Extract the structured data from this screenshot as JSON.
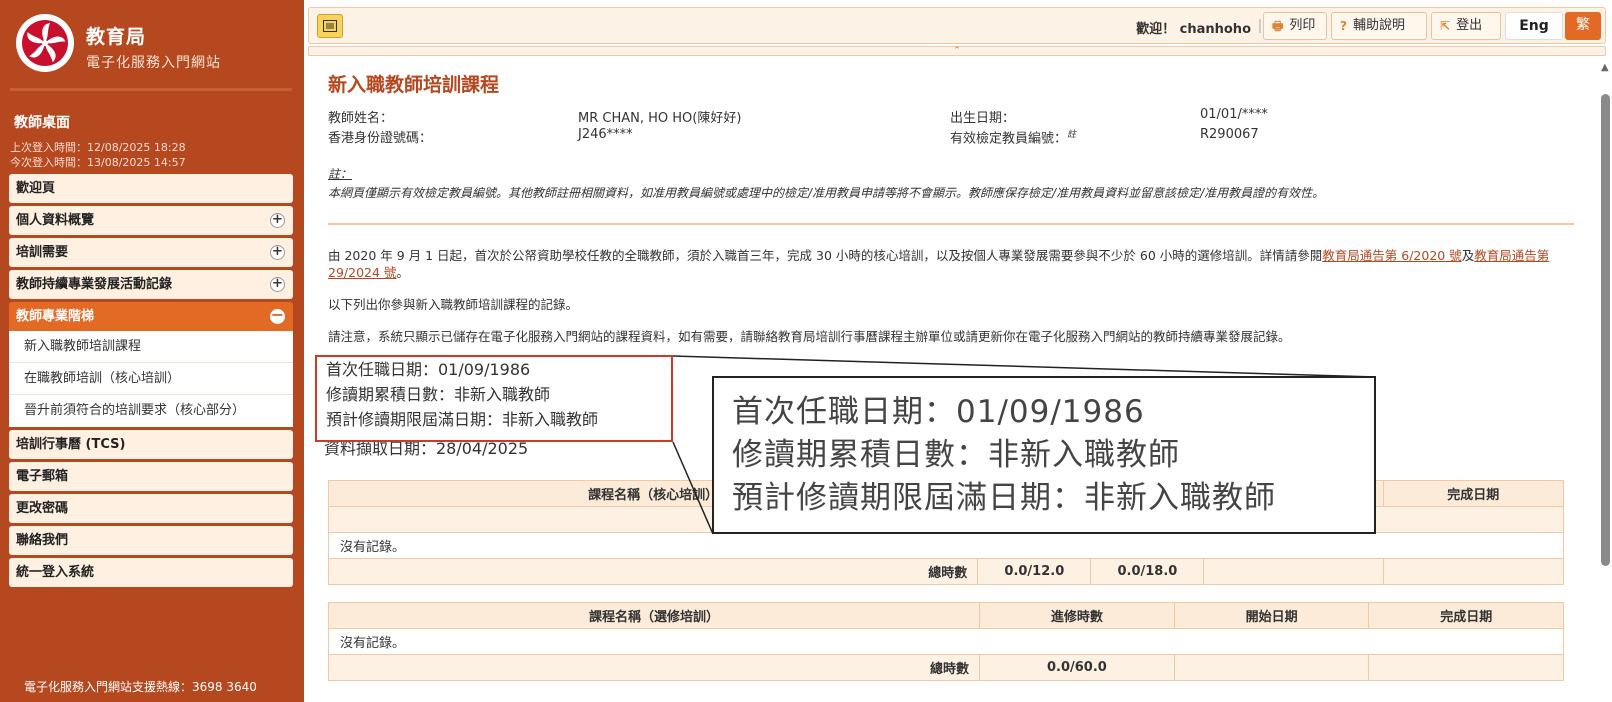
{
  "sidebar": {
    "logo_title": "教育局",
    "logo_subtitle": "電子化服務入門網站",
    "desk_title": "教師桌面",
    "last_login": "上次登入時間：12/08/2025 18:28",
    "this_login": "今次登入時間：13/08/2025 14:57",
    "menu": [
      {
        "label": "歡迎頁",
        "expandable": false
      },
      {
        "label": "個人資料概覽",
        "expandable": true
      },
      {
        "label": "培訓需要",
        "expandable": true
      },
      {
        "label": "教師持續專業發展活動記錄",
        "expandable": true
      },
      {
        "label": "教師專業階梯",
        "active": true
      },
      {
        "label": "培訓行事曆 (TCS)",
        "expandable": false
      },
      {
        "label": "電子郵箱",
        "expandable": false
      },
      {
        "label": "更改密碼",
        "expandable": false
      },
      {
        "label": "聯絡我們",
        "expandable": false
      },
      {
        "label": "統一登入系統",
        "expandable": false
      }
    ],
    "submenu": [
      "新入職教師培訓課程",
      "在職教師培訓（核心培訓）",
      "晉升前須符合的培訓要求（核心部分）"
    ],
    "hotline": "電子化服務入門網站支援熱線：3698 3640"
  },
  "topbar": {
    "welcome": "歡迎！ chanhoho",
    "print": "列印",
    "help": "輔助說明",
    "logout": "登出",
    "lang_en": "Eng",
    "lang_sc": "繁",
    "accent": "#e26a24"
  },
  "page": {
    "title": "新入職教師培訓課程",
    "teacher_name_label": "教師姓名：",
    "teacher_name": "MR CHAN, HO HO(陳好好)",
    "dob_label": "出生日期：",
    "dob": "01/01/****",
    "hkid_label": "香港身份證號碼：",
    "hkid": "J246****",
    "reg_label": "有效檢定教員編號：",
    "reg_note_mark": "註",
    "reg_no": "R290067",
    "note_label": "註：",
    "note_text": "本網頁僅顯示有效檢定教員編號。其他教師註冊相關資料，如准用教員編號或處理中的檢定/准用教員申請等將不會顯示。教師應保存檢定/准用教員資料並留意該檢定/准用教員證的有效性。",
    "intro_before": "由 2020 年 9 月 1 日起，首次於公帑資助學校任教的全職教師，須於入職首三年，完成 30 小時的核心培訓，以及按個人專業發展需要參與不少於 60 小時的選修培訓。詳情請參閱",
    "intro_link1": "教育局通告第 6/2020 號",
    "intro_mid": "及",
    "intro_link2": "教育局通告第 29/2024 號",
    "intro_after": "。",
    "list_text": "以下列出你參與新入職教師培訓課程的記錄。",
    "notice_text": "請注意，系統只顯示已儲存在電子化服務入門網站的課程資料，如有需要，請聯絡教育局培訓行事曆課程主辦單位或請更新你在電子化服務入門網站的教師持續專業發展記錄。",
    "first_appt": "首次任職日期：01/09/1986",
    "accum_days": "修讀期累積日數：非新入職教師",
    "expiry": "預計修讀期限屆滿日期：非新入職教師",
    "retrieve_date": "資料擷取日期：28/04/2025"
  },
  "core_table": {
    "col_course": "課程名稱（核心培訓）",
    "col_done": "完成日期",
    "empty": "沒有記錄。",
    "total_label": "總時數",
    "total_1": "0.0/12.0",
    "total_2": "0.0/18.0"
  },
  "elective_table": {
    "col_course": "課程名稱（選修培訓）",
    "col_hours": "進修時數",
    "col_start": "開始日期",
    "col_done": "完成日期",
    "empty": "沒有記錄。",
    "total_label": "總時數",
    "total": "0.0/60.0"
  }
}
